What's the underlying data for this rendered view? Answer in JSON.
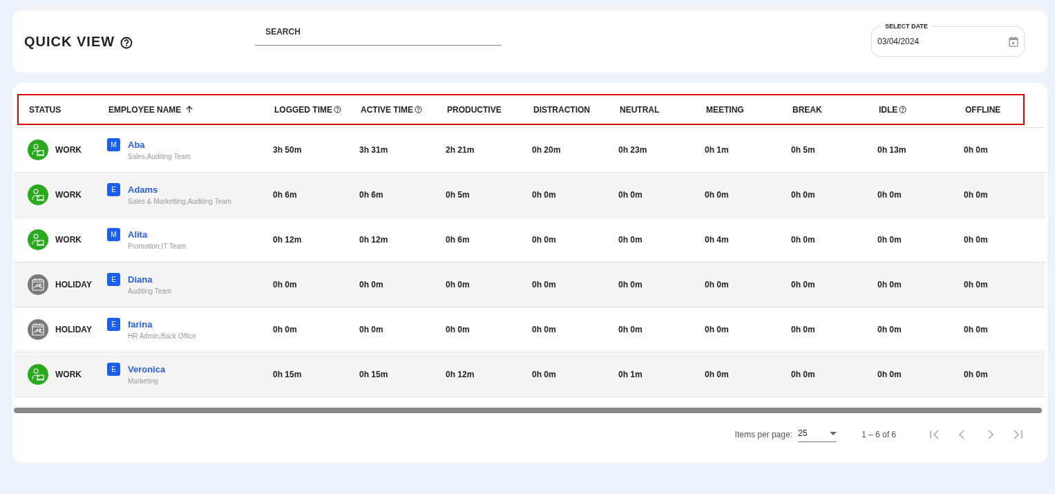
{
  "header": {
    "title": "QUICK VIEW",
    "search": {
      "placeholder": "SEARCH"
    },
    "date": {
      "label": "SELECT DATE",
      "value": "03/04/2024"
    }
  },
  "table": {
    "header_outlined": true,
    "columns": [
      {
        "label": "STATUS",
        "help": false,
        "sorted": false
      },
      {
        "label": "EMPLOYEE NAME",
        "help": false,
        "sorted": true
      },
      {
        "label": "LOGGED TIME",
        "help": true,
        "sorted": false
      },
      {
        "label": "ACTIVE TIME",
        "help": true,
        "sorted": false
      },
      {
        "label": "PRODUCTIVE",
        "help": false,
        "sorted": false
      },
      {
        "label": "DISTRACTION",
        "help": false,
        "sorted": false
      },
      {
        "label": "NEUTRAL",
        "help": false,
        "sorted": false
      },
      {
        "label": "MEETING",
        "help": false,
        "sorted": false
      },
      {
        "label": "BREAK",
        "help": false,
        "sorted": false
      },
      {
        "label": "IDLE",
        "help": true,
        "sorted": false
      },
      {
        "label": "OFFLINE",
        "help": false,
        "sorted": false
      }
    ],
    "rows": [
      {
        "kind": "work",
        "status": "WORK",
        "role": "M",
        "name": "Aba",
        "team": "Sales,Auditing Team",
        "values": [
          "3h 50m",
          "3h 31m",
          "2h 21m",
          "0h 20m",
          "0h 23m",
          "0h 1m",
          "0h 5m",
          "0h 13m",
          "0h 0m"
        ]
      },
      {
        "kind": "work",
        "status": "WORK",
        "role": "E",
        "name": "Adams",
        "team": "Sales & Marketting,Auditing Team",
        "values": [
          "0h 6m",
          "0h 6m",
          "0h 5m",
          "0h 0m",
          "0h 0m",
          "0h 0m",
          "0h 0m",
          "0h 0m",
          "0h 0m"
        ]
      },
      {
        "kind": "work",
        "status": "WORK",
        "role": "M",
        "name": "Alita",
        "team": "Promotion,IT Team",
        "values": [
          "0h 12m",
          "0h 12m",
          "0h 6m",
          "0h 0m",
          "0h 0m",
          "0h 4m",
          "0h 0m",
          "0h 0m",
          "0h 0m"
        ]
      },
      {
        "kind": "holiday",
        "status": "HOLIDAY",
        "role": "E",
        "name": "Diana",
        "team": "Auditing Team",
        "values": [
          "0h 0m",
          "0h 0m",
          "0h 0m",
          "0h 0m",
          "0h 0m",
          "0h 0m",
          "0h 0m",
          "0h 0m",
          "0h 0m"
        ]
      },
      {
        "kind": "holiday",
        "status": "HOLIDAY",
        "role": "E",
        "name": "farina",
        "team": "HR Admin,Back Office",
        "values": [
          "0h 0m",
          "0h 0m",
          "0h 0m",
          "0h 0m",
          "0h 0m",
          "0h 0m",
          "0h 0m",
          "0h 0m",
          "0h 0m"
        ]
      },
      {
        "kind": "work",
        "status": "WORK",
        "role": "E",
        "name": "Veronica",
        "team": "Marketing",
        "values": [
          "0h 15m",
          "0h 15m",
          "0h 12m",
          "0h 0m",
          "0h 1m",
          "0h 0m",
          "0h 0m",
          "0h 0m",
          "0h 0m"
        ]
      }
    ]
  },
  "paginator": {
    "label": "Items per page:",
    "page_size": "25",
    "range": "1 – 6 of 6",
    "first_disabled": true,
    "prev_disabled": true,
    "next_disabled": true,
    "last_disabled": true
  }
}
